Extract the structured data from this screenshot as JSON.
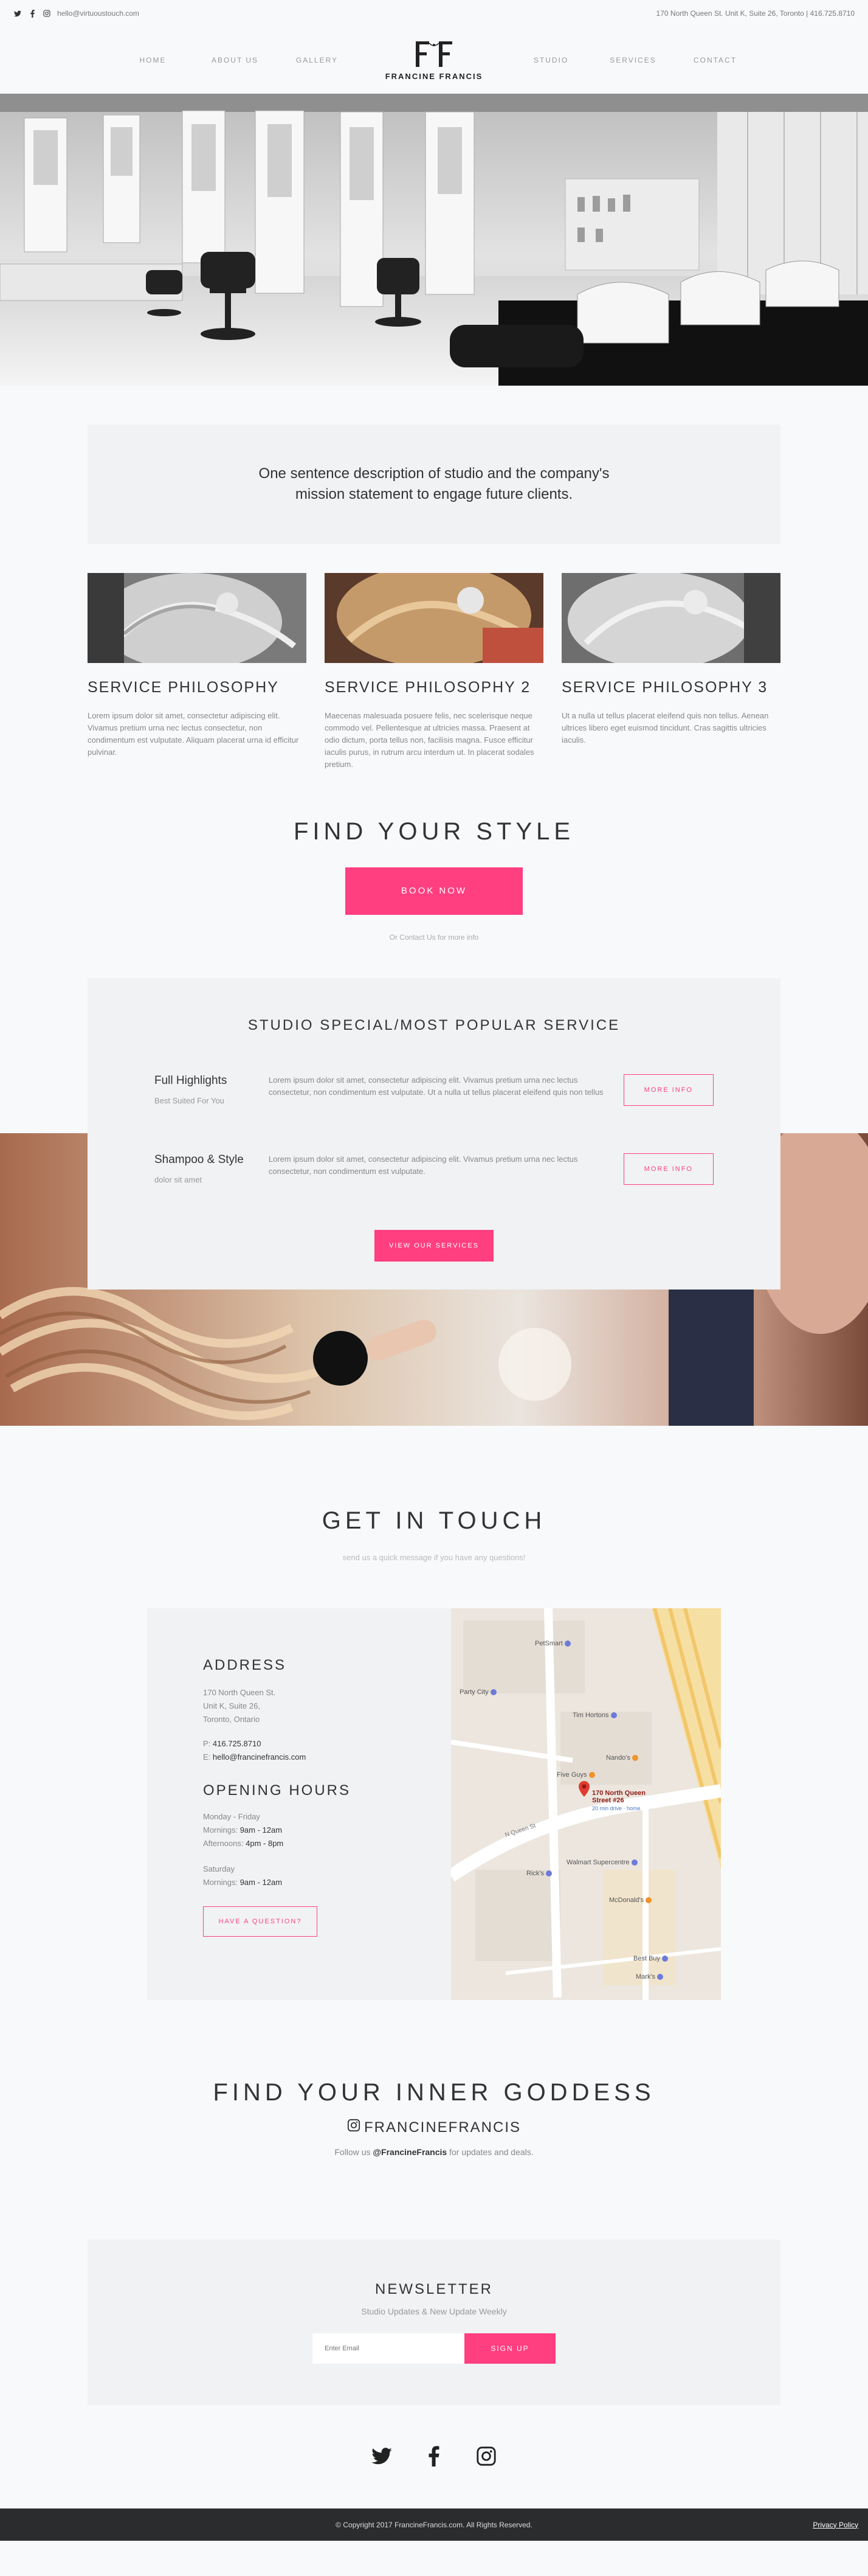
{
  "topbar": {
    "email": "hello@virtuoustouch.com",
    "address": "170 North Queen St. Unit K, Suite 26, Toronto | 416.725.8710",
    "social_icons": [
      "twitter-icon",
      "facebook-icon",
      "instagram-icon"
    ]
  },
  "nav": {
    "left": [
      "HOME",
      "ABOUT US",
      "GALLERY"
    ],
    "right": [
      "STUDIO",
      "SERVICES",
      "CONTACT"
    ],
    "logo_text": "FRANCINE FRANCIS"
  },
  "mission": "One sentence description of studio and the company's mission statement to engage future clients.",
  "services": [
    {
      "title": "SERVICE PHILOSOPHY",
      "text": "Lorem ipsum dolor sit amet, consectetur adipiscing elit. Vivamus pretium urna nec lectus consectetur, non condimentum est vulputate. Aliquam placerat urna id efficitur pulvinar."
    },
    {
      "title": "SERVICE PHILOSOPHY 2",
      "text": "Maecenas malesuada posuere felis, nec scelerisque neque commodo vel. Pellentesque at ultricies massa. Praesent at odio dictum, porta tellus non, facilisis magna. Fusce efficitur iaculis purus, in rutrum arcu interdum ut. In placerat sodales pretium."
    },
    {
      "title": "SERVICE PHILOSOPHY 3",
      "text": "Ut a nulla ut tellus placerat eleifend quis non tellus. Aenean ultrices libero eget euismod tincidunt. Cras sagittis ultricies iaculis."
    }
  ],
  "find_style": {
    "title": "FIND YOUR STYLE",
    "button": "BOOK NOW",
    "note": "Or Contact Us for more info"
  },
  "special": {
    "title": "STUDIO SPECIAL/MOST POPULAR SERVICE",
    "items": [
      {
        "name": "Full Highlights",
        "sub": "Best Suited For You",
        "desc": "Lorem ipsum dolor sit amet, consectetur adipiscing elit. Vivamus pretium urna nec lectus consectetur, non condimentum est vulputate. Ut a nulla ut tellus placerat eleifend quis non tellus",
        "button": "MORE INFO"
      },
      {
        "name": "Shampoo & Style",
        "sub": "dolor sit amet",
        "desc": "Lorem ipsum dolor sit amet, consectetur adipiscing elit. Vivamus pretium urna nec lectus consectetur, non condimentum est vulputate.",
        "button": "MORE INFO"
      }
    ],
    "view_button": "VIEW OUR SERVICES"
  },
  "touch": {
    "title": "GET IN TOUCH",
    "subtitle": "send us a quick message if you have any questions!",
    "address_title": "ADDRESS",
    "address_lines": [
      "170 North Queen St.",
      "Unit K, Suite 26,",
      "Toronto, Ontario"
    ],
    "phone_label": "P:",
    "phone": "416.725.8710",
    "email_label": "E:",
    "email": "hello@francinefrancis.com",
    "hours_title": "OPENING HOURS",
    "weekday_label": "Monday - Friday",
    "mornings_label": "Mornings:",
    "mornings_wk": "9am - 12am",
    "afternoons_label": "Afternoons:",
    "afternoons_wk": "4pm - 8pm",
    "saturday_label": "Saturday",
    "mornings_sat": "9am - 12am",
    "button": "HAVE A QUESTION?"
  },
  "map": {
    "labels": {
      "petsmart": "PetSmart",
      "party_city": "Party City",
      "tim_hortons": "Tim Hortons",
      "nandos": "Nando's",
      "five_guys": "Five Guys",
      "pin_title": "170 North Queen Street #26",
      "pin_sub": "20 min drive · home",
      "street": "N Queen St",
      "ricks": "Rick's",
      "walmart": "Walmart Supercentre",
      "mcdonalds": "McDonald's",
      "best_buy": "Best Buy",
      "marks": "Mark's"
    }
  },
  "goddess": {
    "title": "FIND YOUR INNER GODDESS",
    "handle": "FRANCINEFRANCIS",
    "follow_pre": "Follow us",
    "follow_handle": "@FrancineFrancis",
    "follow_post": "for updates and deals."
  },
  "newsletter": {
    "title": "NEWSLETTER",
    "subtitle": "Studio Updates & New Update Weekly",
    "placeholder": "Enter Email",
    "button": "SIGN UP"
  },
  "footer": {
    "copyright": "© Copyright 2017 FrancineFrancis.com. All Rights Reserved.",
    "privacy": "Privacy Policy"
  },
  "colors": {
    "accent": "#ff3f7f",
    "panel": "#f0f2f3",
    "footer": "#2b2c2e"
  }
}
